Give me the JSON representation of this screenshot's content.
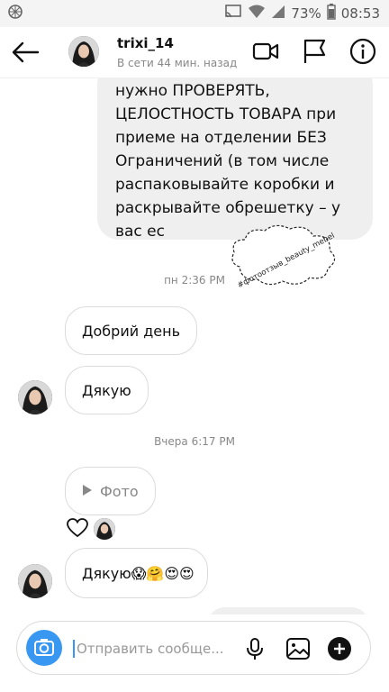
{
  "status_bar": {
    "battery": "73%",
    "time": "08:53"
  },
  "header": {
    "username": "trixi_14",
    "presence": "В сети 44 мин. назад"
  },
  "messages": {
    "received_text": "нужно ПРОВЕРЯТЬ, ЦЕЛОСТНОСТЬ ТОВАРА при приеме на отделении БЕЗ Ограничений (в том числе распаковывайте коробки и раскрывайте обрешетку – у вас ес",
    "watermark": "#фотоотзыв_beauty_mebel",
    "time1": "пн 2:36 PM",
    "msg1": "Добрий день",
    "msg2": "Дякую",
    "time2": "Вчера 6:17 PM",
    "photo_label": "Фото",
    "msg3": "Дякую😱🤗😍😍"
  },
  "composer": {
    "placeholder": "Отправить сообще..."
  },
  "colors": {
    "accent": "#3897f0",
    "bubble_received": "#efefef",
    "border": "#dbdbdb"
  }
}
